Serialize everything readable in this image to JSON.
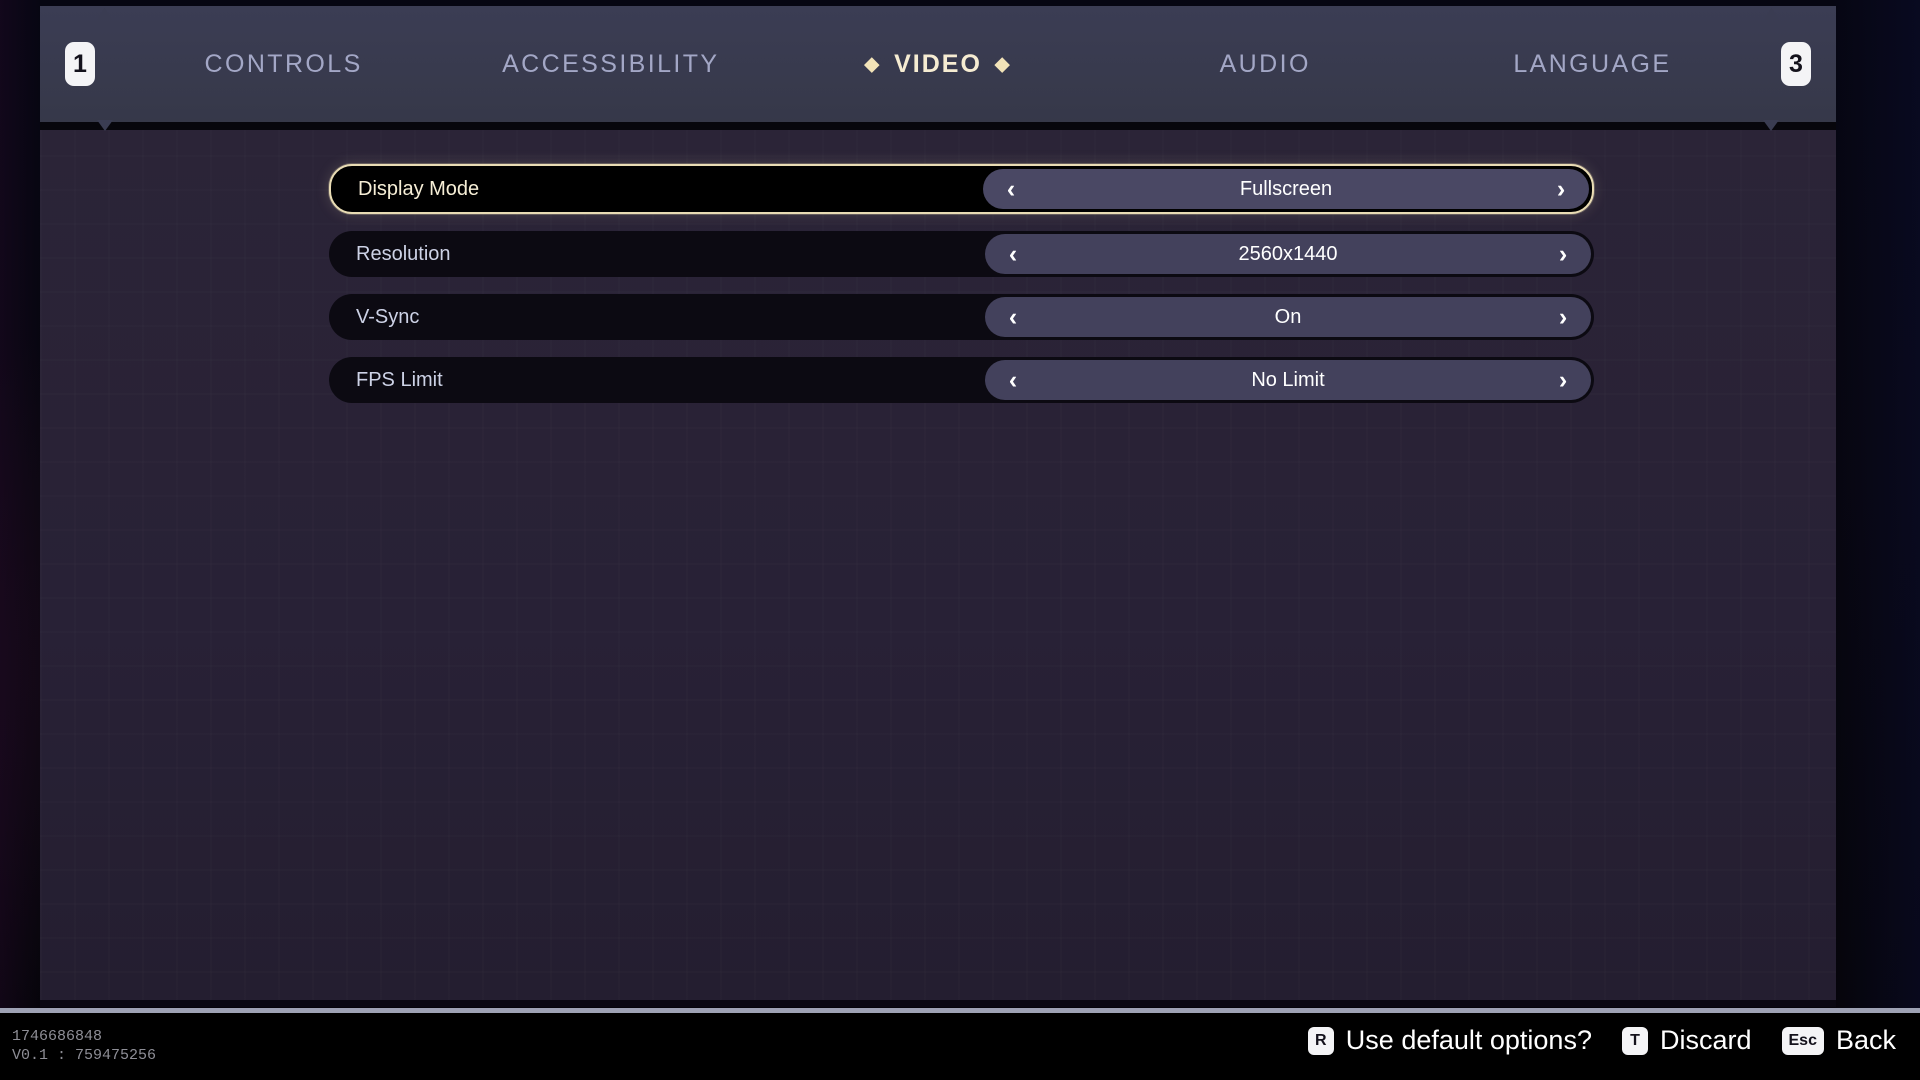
{
  "nav": {
    "prev_key": "1",
    "next_key": "3"
  },
  "tabs": [
    {
      "label": "CONTROLS",
      "active": false
    },
    {
      "label": "ACCESSIBILITY",
      "active": false
    },
    {
      "label": "VIDEO",
      "active": true,
      "marker": "◆"
    },
    {
      "label": "AUDIO",
      "active": false
    },
    {
      "label": "LANGUAGE",
      "active": false
    }
  ],
  "settings": [
    {
      "label": "Display Mode",
      "value": "Fullscreen",
      "selected": true
    },
    {
      "label": "Resolution",
      "value": "2560x1440",
      "selected": false
    },
    {
      "label": "V-Sync",
      "value": "On",
      "selected": false
    },
    {
      "label": "FPS Limit",
      "value": "No Limit",
      "selected": false
    }
  ],
  "selector_icons": {
    "prev": "‹",
    "next": "›"
  },
  "footer": {
    "build_id": "1746686848",
    "version": "V0.1 : 759475256",
    "hints": [
      {
        "key": "R",
        "label": "Use default options?"
      },
      {
        "key": "T",
        "label": "Discard"
      },
      {
        "key": "Esc",
        "label": "Back"
      }
    ]
  },
  "colors": {
    "accent_gold": "#e9dcb4",
    "tab_inactive": "#a3a7c6",
    "panel_bg": "#2b2437",
    "tabbar_bg": "#383a50",
    "row_bg": "#0c0a12",
    "selector_bg": "#43415c"
  }
}
